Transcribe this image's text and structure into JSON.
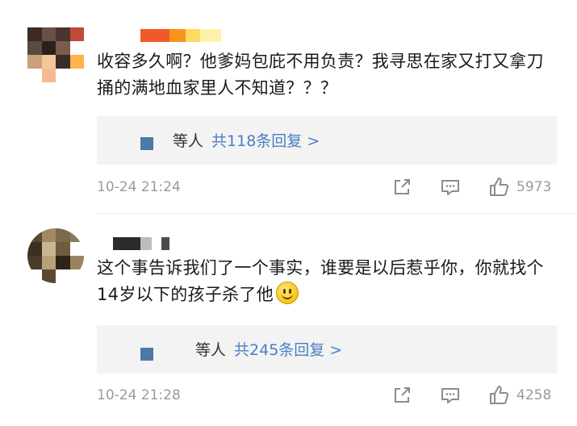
{
  "comments": [
    {
      "text": "收容多久啊？他爹妈包庇不用负责？我寻思在家又打又拿刀捅的满地血家里人不知道？？？",
      "reply": {
        "prefix": "等人",
        "link": "共118条回复 >"
      },
      "time": "10-24 21:24",
      "likes": "5973",
      "avatar_colors": [
        "#3e2a22",
        "#6b5046",
        "#4a3530",
        "#c04a3a",
        "#5b4a40",
        "#2b211c",
        "#7a5b4c",
        "#ffffff",
        "#c9a07a",
        "#f2c89a",
        "#3a2c26",
        "#ffb34a",
        "#ffffff",
        "#f7b894",
        "#ffffff",
        "#ffffff"
      ],
      "username_colors": [
        "#f05a28",
        "#f7941d",
        "#ffd966",
        "#fff2a8"
      ]
    },
    {
      "text": "这个事告诉我们了一个事实，谁要是以后惹乎你，你就找个14岁以下的孩子杀了他",
      "reply": {
        "prefix": "等人",
        "link": "共245条回复 >"
      },
      "time": "10-24 21:28",
      "likes": "4258",
      "avatar_colors": [
        "#5b4a2c",
        "#a08a64",
        "#7a6a4c",
        "#8c7a5a",
        "#3d3020",
        "#c9b590",
        "#6f5c3e",
        "#ffffff",
        "#4a3b28",
        "#b8a07a",
        "#2e2418",
        "#9a8460",
        "#ffffff",
        "#5a482e",
        "#ffffff",
        "#ffffff"
      ],
      "username_colors": [
        "#2b2b2b",
        "#bdbdbd",
        "#ffffff",
        "#4a4a4a"
      ]
    }
  ]
}
